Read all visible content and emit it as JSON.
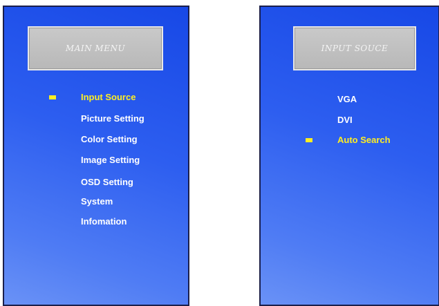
{
  "main_menu": {
    "title": "MAIN MENU",
    "items": [
      {
        "label": "Input Source",
        "selected": true
      },
      {
        "label": "Picture Setting",
        "selected": false
      },
      {
        "label": "Color Setting",
        "selected": false
      },
      {
        "label": "Image Setting",
        "selected": false
      },
      {
        "label": "OSD Setting",
        "selected": false
      },
      {
        "label": "System",
        "selected": false
      },
      {
        "label": "Infomation",
        "selected": false
      }
    ]
  },
  "input_source_menu": {
    "title": "INPUT SOUCE",
    "items": [
      {
        "label": "VGA",
        "selected": false
      },
      {
        "label": "DVI",
        "selected": false
      },
      {
        "label": "Auto Search",
        "selected": true
      }
    ]
  },
  "colors": {
    "panel_blue": "#1748e6",
    "selected_text": "#ffee22",
    "normal_text": "#ffffff",
    "title_box_gray": "#c0c0c0"
  }
}
